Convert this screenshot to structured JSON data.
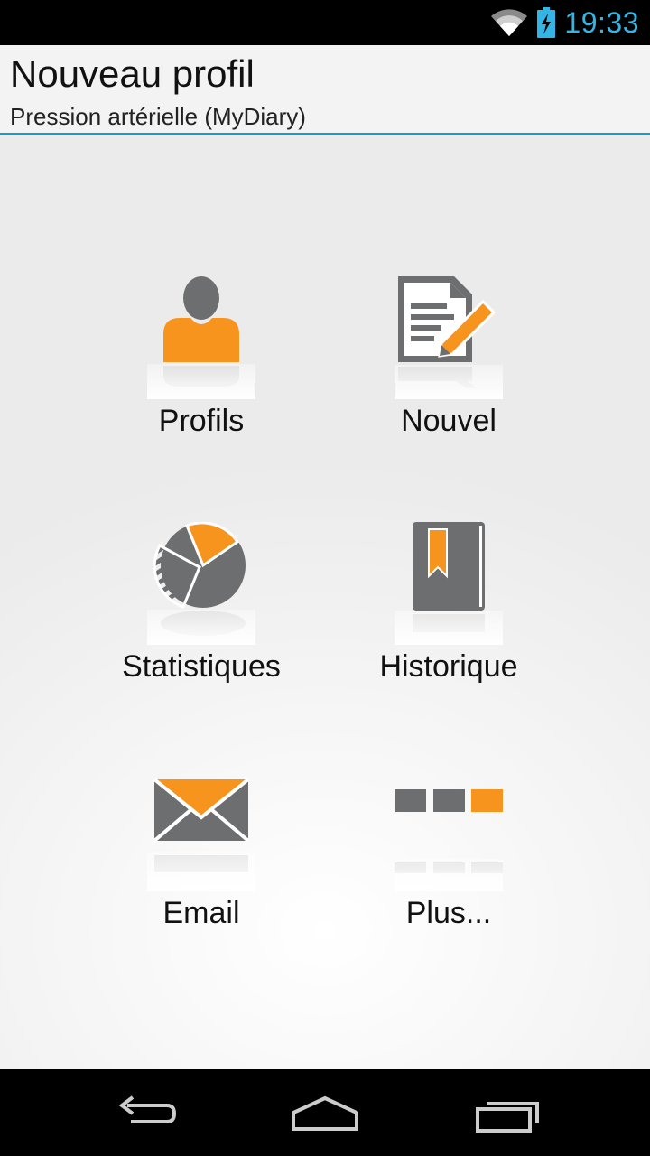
{
  "status_bar": {
    "time": "19:33",
    "icons": [
      "wifi-icon",
      "battery-charging-icon"
    ],
    "accent_color": "#33b5e5"
  },
  "action_bar": {
    "title": "Nouveau profil",
    "subtitle": "Pression artérielle (MyDiary)",
    "divider_color": "#1a9cc4"
  },
  "dashboard": {
    "tiles": [
      {
        "label": "Profils",
        "icon": "profile-icon"
      },
      {
        "label": "Nouvel",
        "icon": "new-entry-icon"
      },
      {
        "label": "Statistiques",
        "icon": "statistics-icon"
      },
      {
        "label": "Historique",
        "icon": "history-icon"
      },
      {
        "label": "Email",
        "icon": "email-icon"
      },
      {
        "label": "Plus...",
        "icon": "more-icon"
      }
    ],
    "icon_colors": {
      "gray": "#6d6e70",
      "orange": "#f7941d"
    }
  },
  "nav_bar": {
    "buttons": [
      "back-icon",
      "home-icon",
      "recent-apps-icon"
    ]
  }
}
